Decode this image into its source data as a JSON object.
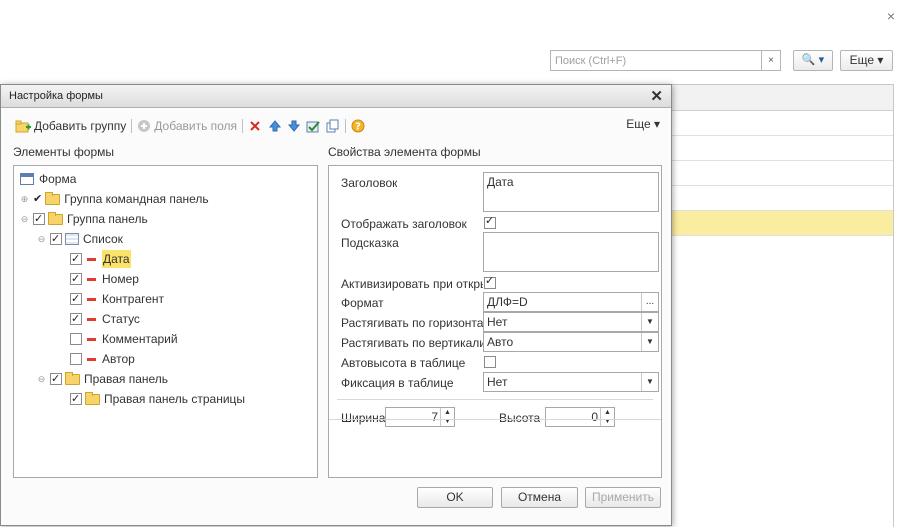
{
  "background": {
    "close_glyph": "×",
    "search_placeholder": "Поиск (Ctrl+F)",
    "search_clear": "×",
    "search_btn": "🔍 ▾",
    "more_btn": "Еще ▾"
  },
  "dialog": {
    "title": "Настройка формы",
    "close_glyph": "✕",
    "toolbar": {
      "add_group": "Добавить группу",
      "add_fields": "Добавить поля",
      "more": "Еще ▾"
    },
    "left_header": "Элементы формы",
    "right_header": "Свойства элемента формы",
    "tree": {
      "form": "Форма",
      "command_panel": "Группа командная панель",
      "panel_group": "Группа панель",
      "list": "Список",
      "fields": [
        "Дата",
        "Номер",
        "Контрагент",
        "Статус",
        "Комментарий",
        "Автор"
      ],
      "right_panel": "Правая панель",
      "right_panel_pages": "Правая панель страницы"
    },
    "props": {
      "caption_label": "Заголовок",
      "caption_value": "Дата",
      "show_caption_label": "Отображать заголовок",
      "tooltip_label": "Подсказка",
      "tooltip_value": "",
      "activate_label": "Активизировать при откры",
      "format_label": "Формат",
      "format_value": "ДЛФ=D",
      "format_btn": "...",
      "stretch_h_label": "Растягивать по горизонтал",
      "stretch_h_value": "Нет",
      "stretch_v_label": "Растягивать по вертикали",
      "stretch_v_value": "Авто",
      "autoheight_label": "Автовысота в таблице",
      "fix_label": "Фиксация в таблице",
      "fix_value": "Нет",
      "width_label": "Ширина",
      "width_value": "7",
      "height_label": "Высота",
      "height_value": "0"
    },
    "buttons": {
      "ok": "OK",
      "cancel": "Отмена",
      "apply": "Применить"
    }
  }
}
